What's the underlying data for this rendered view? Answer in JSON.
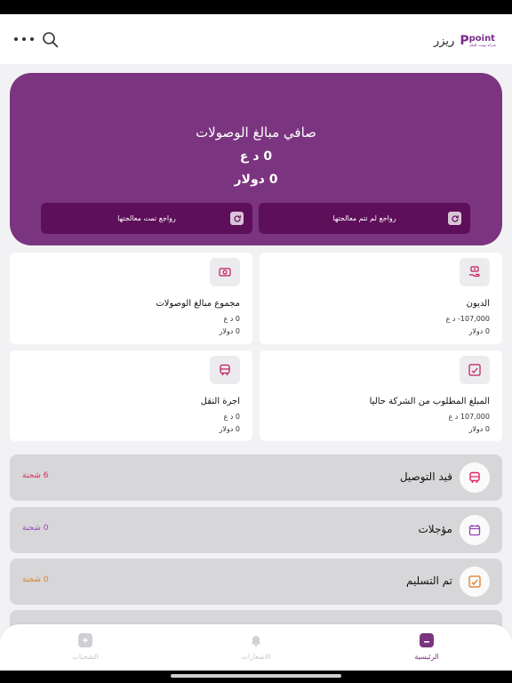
{
  "header": {
    "brand_mark": "P",
    "brand_text": "point",
    "brand_sub": "ِشركة بوينت للنقل",
    "user_name": "ريزر"
  },
  "hero": {
    "title": "صافي مبالغ الوصولات",
    "amount_iqd": "0 د ع",
    "amount_usd": "0 دولار",
    "btn_unprocessed": "رواجع لم تتم معالجتها",
    "btn_processed": "رواجع تمت معالجتها"
  },
  "cards": {
    "debts": {
      "title": "الديون",
      "iqd": "107,000- د ع",
      "usd": "0 دولار"
    },
    "receipts_total": {
      "title": "مجموع مبالغ الوصولات",
      "iqd": "0 د ع",
      "usd": "0 دولار"
    },
    "required": {
      "title": "المبلغ المطلوب من الشركة حاليا",
      "iqd": "107,000 د ع",
      "usd": "0 دولار"
    },
    "transport": {
      "title": "اجرة النقل",
      "iqd": "0 د ع",
      "usd": "0 دولار"
    }
  },
  "statuses": [
    {
      "label": "قيد التوصيل",
      "count": "6 شحنة",
      "color": "#e0245e"
    },
    {
      "label": "مؤجلات",
      "count": "0 شحنة",
      "color": "#9b3fb5"
    },
    {
      "label": "تم التسليم",
      "count": "0 شحنة",
      "color": "#e07a1f"
    }
  ],
  "nav": {
    "home": "الرئيسية",
    "notifications": "الاشعارات",
    "shipments": "الشحنات"
  },
  "colors": {
    "brand": "#7b347f",
    "brand_dark": "#5e0f59"
  }
}
